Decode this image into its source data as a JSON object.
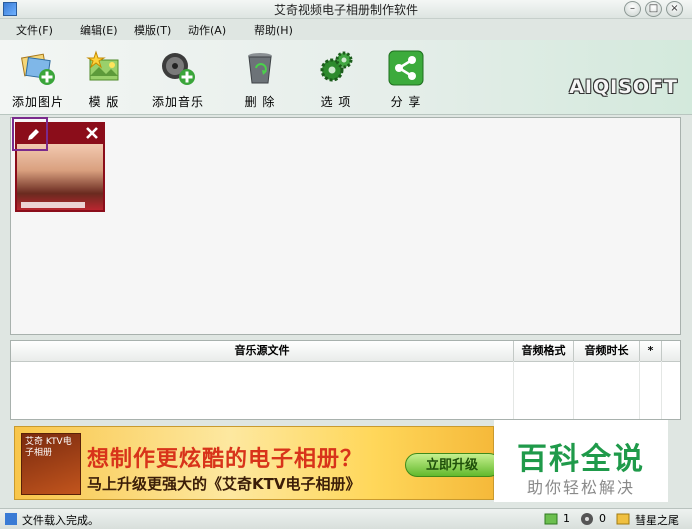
{
  "window": {
    "title": "艾奇视频电子相册制作软件",
    "buttons": [
      "–",
      "□",
      "×"
    ]
  },
  "menu": [
    {
      "label": "文件(F)"
    },
    {
      "label": "编辑(E)"
    },
    {
      "label": "模版(T)"
    },
    {
      "label": "动作(A)"
    },
    {
      "label": "帮助(H)"
    }
  ],
  "toolbar": [
    {
      "label": "添加图片",
      "icon": "add-photo-icon"
    },
    {
      "label": "模 版",
      "icon": "template-icon"
    },
    {
      "label": "添加音乐",
      "icon": "add-music-icon"
    },
    {
      "label": "删 除",
      "icon": "trash-icon"
    },
    {
      "label": "选 项",
      "icon": "gears-icon"
    },
    {
      "label": "分 享",
      "icon": "share-icon"
    }
  ],
  "logo": "AIQISOFT",
  "music_table": {
    "columns": [
      "音乐源文件",
      "音频格式",
      "音频时长",
      "*"
    ]
  },
  "banner": {
    "cover_text": "艾奇 KTV电子相册",
    "line1": "想制作更炫酷的电子相册？",
    "line2": "马上升级更强大的《艾奇KTV电子相册》",
    "button": "立即升级"
  },
  "watermark": {
    "title": "百科全说",
    "subtitle": "助你轻松解决"
  },
  "status": {
    "message": "文件载入完成。",
    "photo_count": "1",
    "music_count": "0",
    "template_name": "彗星之尾"
  },
  "colors": {
    "accent_green": "#1f9a4a",
    "highlight": "#7a2a8c",
    "banner_red": "#d8331a"
  }
}
